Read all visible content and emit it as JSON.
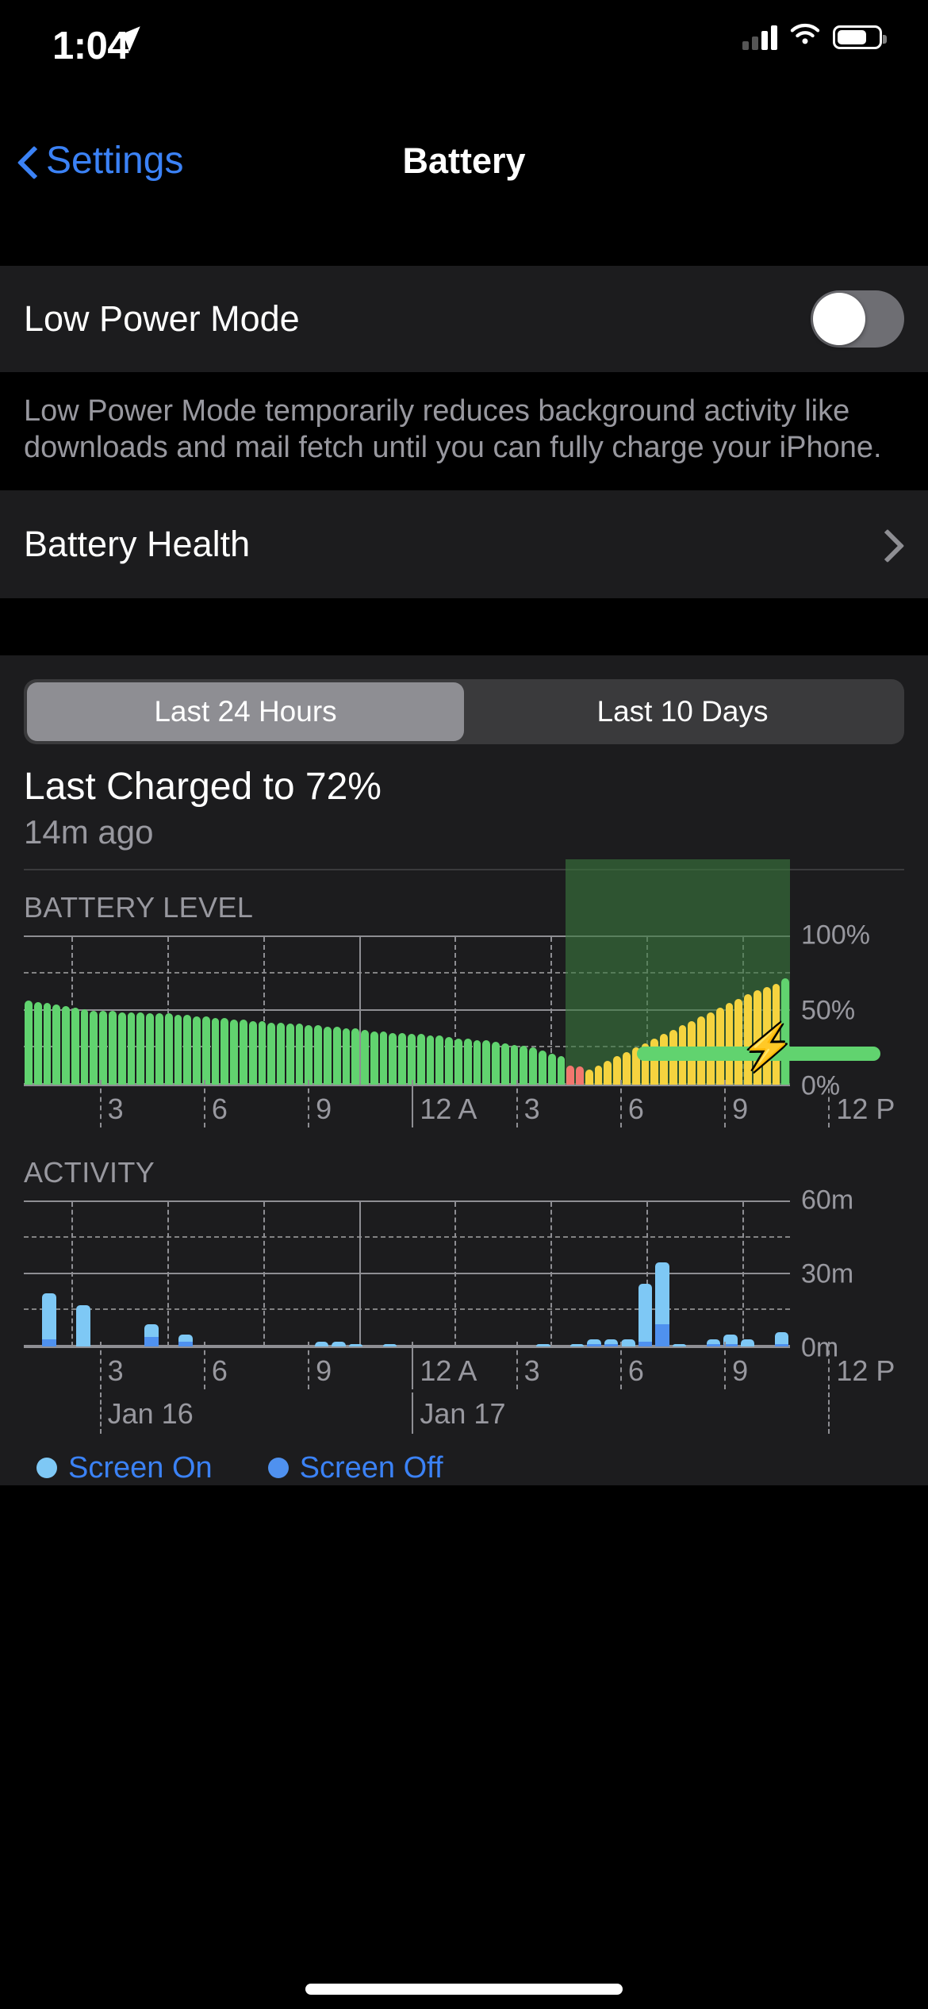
{
  "statusbar": {
    "time": "1:04",
    "location_icon": "location-arrow-icon",
    "cellular_icon": "cellular-bars-icon",
    "wifi_icon": "wifi-icon",
    "battery_icon": "battery-icon"
  },
  "nav": {
    "back_label": "Settings",
    "title": "Battery"
  },
  "low_power": {
    "label": "Low Power Mode",
    "toggle_state": "off",
    "footer": "Low Power Mode temporarily reduces background activity like downloads and mail fetch until you can fully charge your iPhone."
  },
  "battery_health": {
    "label": "Battery Health"
  },
  "segmented": {
    "options": [
      "Last 24 Hours",
      "Last 10 Days"
    ],
    "selected": "Last 24 Hours"
  },
  "last_charged": {
    "title": "Last Charged to 72%",
    "subtitle": "14m ago"
  },
  "sections": {
    "battery_level": "BATTERY LEVEL",
    "activity": "ACTIVITY"
  },
  "legend": {
    "screen_on": "Screen On",
    "screen_off": "Screen Off"
  },
  "colors": {
    "accent": "#3b82f6",
    "green": "#61d36f",
    "yellow": "#f5d33f",
    "red": "#f2776f",
    "screen_on": "#7ec8f5",
    "screen_off": "#4f91ef",
    "charging_band": "#3a783e"
  },
  "chart_data": [
    {
      "type": "bar",
      "title": "BATTERY LEVEL",
      "xlabel": "",
      "ylabel": "%",
      "ylim": [
        0,
        100
      ],
      "yticks": [
        0,
        50,
        100
      ],
      "ytick_labels": [
        "0%",
        "50%",
        "100%"
      ],
      "gridlines": [
        0,
        25,
        50,
        75,
        100
      ],
      "xtick_labels": [
        "3",
        "6",
        "9",
        "12 A",
        "3",
        "6",
        "9",
        "12 P"
      ],
      "date_labels": [
        "Jan 16",
        "Jan 17"
      ],
      "charging_band": {
        "start_index": 58,
        "end_index": 82,
        "label": "charging"
      },
      "values": [
        57,
        56,
        55,
        54,
        53,
        52,
        51,
        50,
        50,
        50,
        49,
        49,
        49,
        48,
        48,
        48,
        47,
        47,
        46,
        46,
        45,
        45,
        44,
        44,
        43,
        43,
        42,
        42,
        41,
        41,
        40,
        40,
        39,
        39,
        38,
        38,
        37,
        36,
        36,
        35,
        35,
        34,
        34,
        33,
        33,
        32,
        31,
        31,
        30,
        30,
        29,
        28,
        27,
        26,
        25,
        23,
        21,
        19,
        13,
        12,
        10,
        13,
        16,
        19,
        22,
        25,
        28,
        31,
        34,
        37,
        40,
        43,
        46,
        49,
        52,
        55,
        58,
        61,
        64,
        66,
        68,
        72
      ],
      "bar_colors": [
        "g",
        "g",
        "g",
        "g",
        "g",
        "g",
        "g",
        "g",
        "g",
        "g",
        "g",
        "g",
        "g",
        "g",
        "g",
        "g",
        "g",
        "g",
        "g",
        "g",
        "g",
        "g",
        "g",
        "g",
        "g",
        "g",
        "g",
        "g",
        "g",
        "g",
        "g",
        "g",
        "g",
        "g",
        "g",
        "g",
        "g",
        "g",
        "g",
        "g",
        "g",
        "g",
        "g",
        "g",
        "g",
        "g",
        "g",
        "g",
        "g",
        "g",
        "g",
        "g",
        "g",
        "g",
        "g",
        "g",
        "g",
        "g",
        "r",
        "r",
        "y",
        "y",
        "y",
        "y",
        "y",
        "y",
        "y",
        "y",
        "y",
        "y",
        "y",
        "y",
        "y",
        "y",
        "y",
        "y",
        "y",
        "y",
        "y",
        "y",
        "y",
        "g"
      ]
    },
    {
      "type": "bar",
      "title": "ACTIVITY",
      "xlabel": "",
      "ylabel": "minutes",
      "ylim": [
        0,
        60
      ],
      "yticks": [
        0,
        30,
        60
      ],
      "ytick_labels": [
        "0m",
        "30m",
        "60m"
      ],
      "gridlines": [
        0,
        15,
        30,
        45,
        60
      ],
      "xtick_labels": [
        "3",
        "6",
        "9",
        "12 A",
        "3",
        "6",
        "9",
        "12 P"
      ],
      "date_labels": [
        "Jan 16",
        "Jan 17"
      ],
      "series": [
        {
          "name": "Screen On",
          "values": [
            0,
            19,
            0,
            17,
            0,
            0,
            0,
            5,
            0,
            3,
            0,
            0,
            0,
            0,
            0,
            0,
            0,
            2,
            2,
            1,
            0,
            1,
            0,
            0,
            0,
            0,
            0,
            0,
            0,
            0,
            1,
            0,
            1,
            2,
            2,
            3,
            24,
            26,
            1,
            0,
            2,
            4,
            3,
            0,
            5
          ]
        },
        {
          "name": "Screen Off",
          "values": [
            0,
            3,
            0,
            0,
            0,
            0,
            0,
            4,
            0,
            2,
            0,
            0,
            0,
            0,
            0,
            0,
            0,
            0,
            0,
            0,
            0,
            0,
            0,
            0,
            0,
            0,
            0,
            0,
            0,
            0,
            0,
            0,
            0,
            1,
            1,
            0,
            2,
            9,
            0,
            0,
            1,
            1,
            0,
            0,
            1
          ]
        }
      ]
    }
  ]
}
